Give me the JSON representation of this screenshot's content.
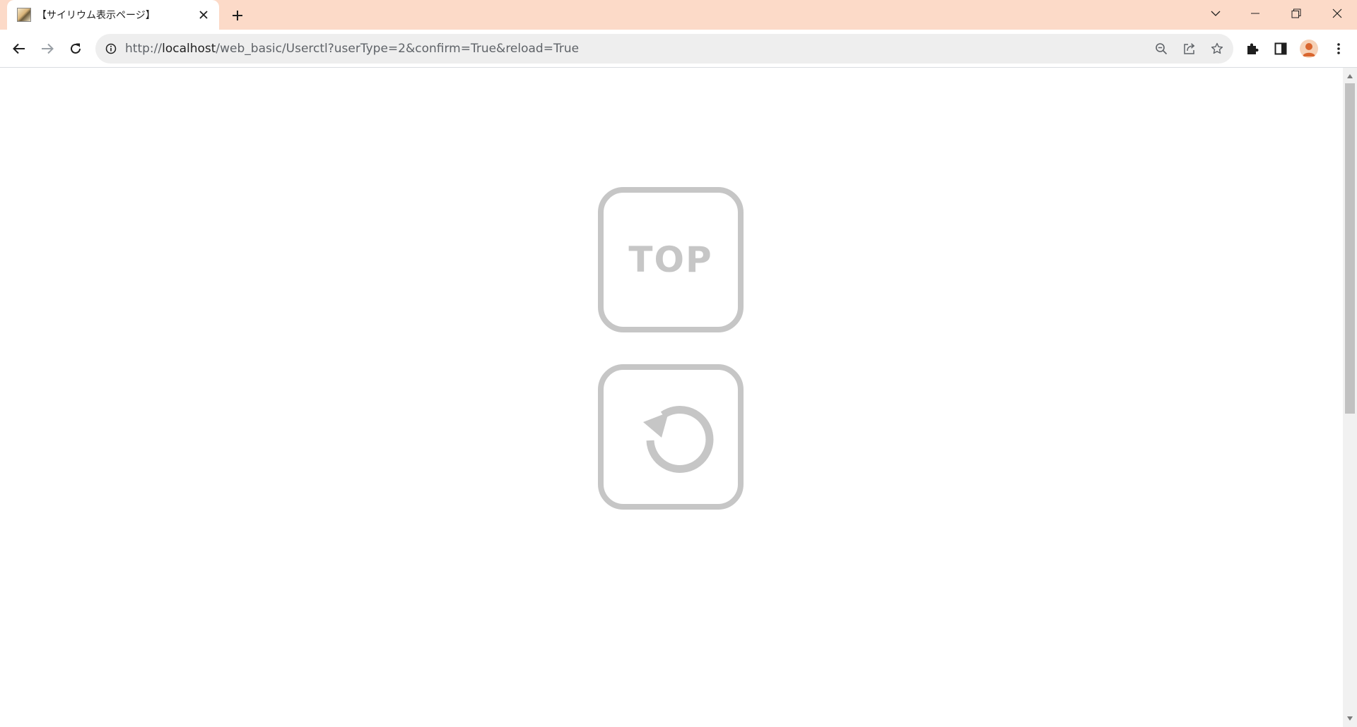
{
  "tab": {
    "title": "【サイリウム表示ページ】",
    "favicon": "page-favicon"
  },
  "toolbar": {
    "url_prefix": "http://",
    "url_host": "localhost",
    "url_path": "/web_basic/Userctl?userType=2&confirm=True&reload=True"
  },
  "content": {
    "top_button_label": "TOP",
    "reload_button_icon": "reload-icon"
  },
  "colors": {
    "tabstrip_bg": "#fcdac8",
    "button_gray": "#c6c6c6",
    "avatar_accent": "#d9662f"
  }
}
